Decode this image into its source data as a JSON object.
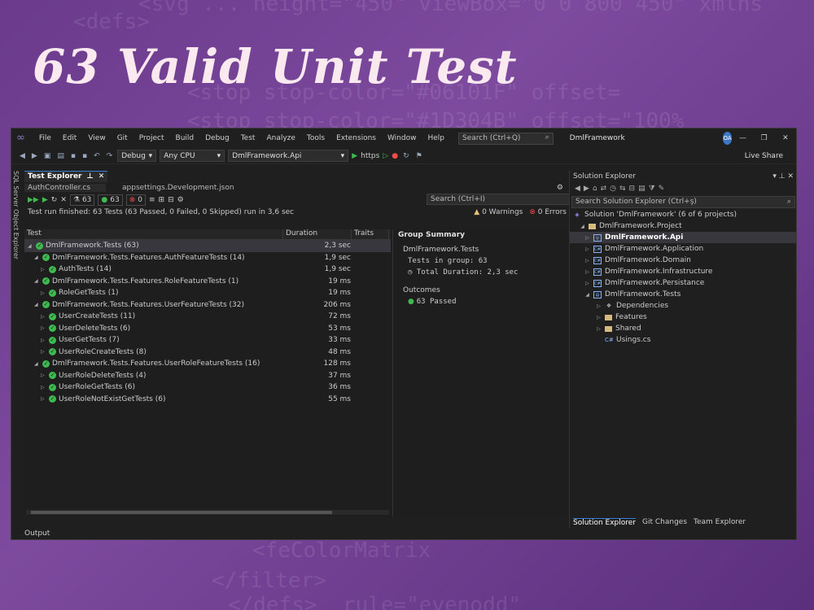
{
  "background_code_lines": [
    "<svg ... height=\"450\" viewBox=\"0 0 800 450\" xmlns",
    "<defs>",
    "<stop stop-color=\"#06101F\" offset=",
    "<stop stop-color=\"#1D304B\" offset=\"100%",
    "<feColorMatrix",
    "</filter>",
    "</defs>  rule=\"evenodd\""
  ],
  "headline": "63 Valid Unit Test",
  "menu": {
    "items": [
      "File",
      "Edit",
      "View",
      "Git",
      "Project",
      "Build",
      "Debug",
      "Test",
      "Analyze",
      "Tools",
      "Extensions",
      "Window",
      "Help"
    ],
    "search_placeholder": "Search (Ctrl+Q)",
    "solution_title": "DmlFramework",
    "avatar_initials": "OA"
  },
  "toolbar": {
    "config": "Debug",
    "platform": "Any CPU",
    "startup_project": "DmlFramework.Api",
    "run_target": "https",
    "live_share": "Live Share"
  },
  "sidebar_label": "SQL Server Object Explorer",
  "test_explorer": {
    "tab_label": "Test Explorer",
    "doc_tabs": [
      "AuthController.cs",
      "appsettings.Development.json"
    ],
    "counts": {
      "total": "63",
      "passed": "63",
      "failed": "0"
    },
    "search_placeholder": "Search (Ctrl+I)",
    "status": "Test run finished: 63 Tests (63 Passed, 0 Failed, 0 Skipped) run in 3,6 sec",
    "warnings": "0 Warnings",
    "errors": "0 Errors",
    "columns": [
      "Test",
      "Duration",
      "Traits"
    ],
    "rows": [
      {
        "name": "DmlFramework.Tests (63)",
        "duration": "2,3 sec"
      },
      {
        "name": "DmlFramework.Tests.Features.AuthFeatureTests (14)",
        "duration": "1,9 sec"
      },
      {
        "name": "AuthTests (14)",
        "duration": "1,9 sec"
      },
      {
        "name": "DmlFramework.Tests.Features.RoleFeatureTests (1)",
        "duration": "19 ms"
      },
      {
        "name": "RoleGetTests (1)",
        "duration": "19 ms"
      },
      {
        "name": "DmlFramework.Tests.Features.UserFeatureTests (32)",
        "duration": "206 ms"
      },
      {
        "name": "UserCreateTests (11)",
        "duration": "72 ms"
      },
      {
        "name": "UserDeleteTests (6)",
        "duration": "53 ms"
      },
      {
        "name": "UserGetTests (7)",
        "duration": "33 ms"
      },
      {
        "name": "UserRoleCreateTests (8)",
        "duration": "48 ms"
      },
      {
        "name": "DmlFramework.Tests.Features.UserRoleFeatureTests (16)",
        "duration": "128 ms"
      },
      {
        "name": "UserRoleDeleteTests (4)",
        "duration": "37 ms"
      },
      {
        "name": "UserRoleGetTests (6)",
        "duration": "36 ms"
      },
      {
        "name": "UserRoleNotExistGetTests (6)",
        "duration": "55 ms"
      }
    ]
  },
  "group_summary": {
    "heading": "Group Summary",
    "group_name": "DmlFramework.Tests",
    "tests_in_group": "Tests in group: 63",
    "total_duration": "Total Duration: 2,3 sec",
    "outcomes_heading": "Outcomes",
    "passed": "63 Passed"
  },
  "solution_explorer": {
    "title": "Solution Explorer",
    "search_placeholder": "Search Solution Explorer (Ctrl+ş)",
    "nodes": [
      {
        "label": "Solution 'DmlFramework' (6 of 6 projects)"
      },
      {
        "label": "DmlFramework.Project"
      },
      {
        "label": "DmlFramework.Api"
      },
      {
        "label": "DmlFramework.Application"
      },
      {
        "label": "DmlFramework.Domain"
      },
      {
        "label": "DmlFramework.Infrastructure"
      },
      {
        "label": "DmlFramework.Persistance"
      },
      {
        "label": "DmlFramework.Tests"
      },
      {
        "label": "Dependencies"
      },
      {
        "label": "Features"
      },
      {
        "label": "Shared"
      },
      {
        "label": "Usings.cs"
      }
    ],
    "bottom_tabs": [
      "Solution Explorer",
      "Git Changes",
      "Team Explorer"
    ]
  },
  "output_label": "Output",
  "colors": {
    "accent": "#3c7bd6",
    "pass": "#3fb950",
    "fail": "#f14c4c",
    "ide_bg": "#1f1f1f"
  }
}
